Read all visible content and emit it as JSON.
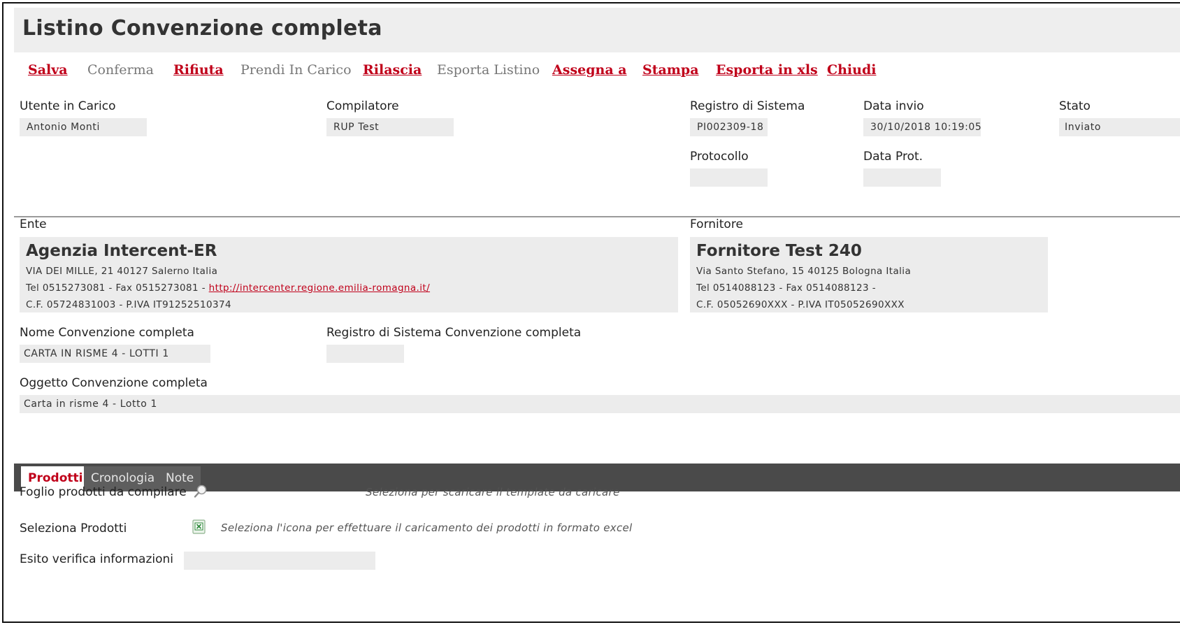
{
  "page": {
    "title": "Listino Convenzione completa"
  },
  "toolbar": {
    "items": [
      {
        "label": "Salva",
        "state": "enabled"
      },
      {
        "label": "Conferma",
        "state": "disabled"
      },
      {
        "label": "Rifiuta",
        "state": "enabled"
      },
      {
        "label": "Prendi In Carico",
        "state": "disabled"
      },
      {
        "label": "Rilascia",
        "state": "enabled"
      },
      {
        "label": "Esporta Listino",
        "state": "disabled"
      },
      {
        "label": "Assegna a",
        "state": "enabled"
      },
      {
        "label": "Stampa",
        "state": "enabled"
      },
      {
        "label": "Esporta in xls",
        "state": "enabled"
      },
      {
        "label": "Chiudi",
        "state": "enabled"
      }
    ]
  },
  "header_fields": {
    "utente": {
      "label": "Utente in Carico",
      "value": "Antonio Monti"
    },
    "compilatore": {
      "label": "Compilatore",
      "value": "RUP Test"
    },
    "registro": {
      "label": "Registro di Sistema",
      "value": "PI002309-18"
    },
    "data_invio": {
      "label": "Data invio",
      "value": "30/10/2018 10:19:05"
    },
    "stato": {
      "label": "Stato",
      "value": "Inviato"
    },
    "protocollo": {
      "label": "Protocollo",
      "value": ""
    },
    "data_prot": {
      "label": "Data Prot.",
      "value": ""
    }
  },
  "ente": {
    "label": "Ente",
    "name": "Agenzia Intercent-ER",
    "address": "VIA DEI MILLE, 21 40127 Salerno Italia",
    "contacts": "Tel 0515273081 - Fax 0515273081 - ",
    "url": "http://intercenter.regione.emilia-romagna.it/",
    "fiscal": "C.F. 05724831003 - P.IVA IT91252510374"
  },
  "fornitore": {
    "label": "Fornitore",
    "name": "Fornitore Test 240",
    "address": "Via Santo Stefano, 15 40125 Bologna Italia",
    "contacts": "Tel 0514088123 - Fax 0514088123 -",
    "fiscal": "C.F. 05052690XXX - P.IVA IT05052690XXX"
  },
  "convenzione": {
    "nome_label": "Nome Convenzione completa",
    "nome_value": "CARTA IN RISME 4 - LOTTI 1",
    "registro_label": "Registro di Sistema Convenzione completa",
    "registro_value": "",
    "oggetto_label": "Oggetto Convenzione completa",
    "oggetto_value": "Carta in risme 4 - Lotto 1"
  },
  "tabs": [
    {
      "label": "Prodotti",
      "active": true
    },
    {
      "label": "Cronologia",
      "active": false
    },
    {
      "label": "Note",
      "active": false
    }
  ],
  "prodotti": {
    "foglio_label": "Foglio prodotti da compilare",
    "foglio_icon": "search-icon",
    "foglio_hint": "Seleziona per scaricare il template da caricare",
    "seleziona_label": "Seleziona Prodotti",
    "seleziona_icon": "excel-upload-icon",
    "seleziona_hint": "Seleziona l'icona per effettuare il caricamento dei prodotti in formato excel",
    "esito_label": "Esito verifica informazioni",
    "esito_value": ""
  },
  "colors": {
    "accent": "#c0001a",
    "tab_bar": "#4a4a4a",
    "field_bg": "#ececec",
    "title_bg": "#eeeeee"
  }
}
